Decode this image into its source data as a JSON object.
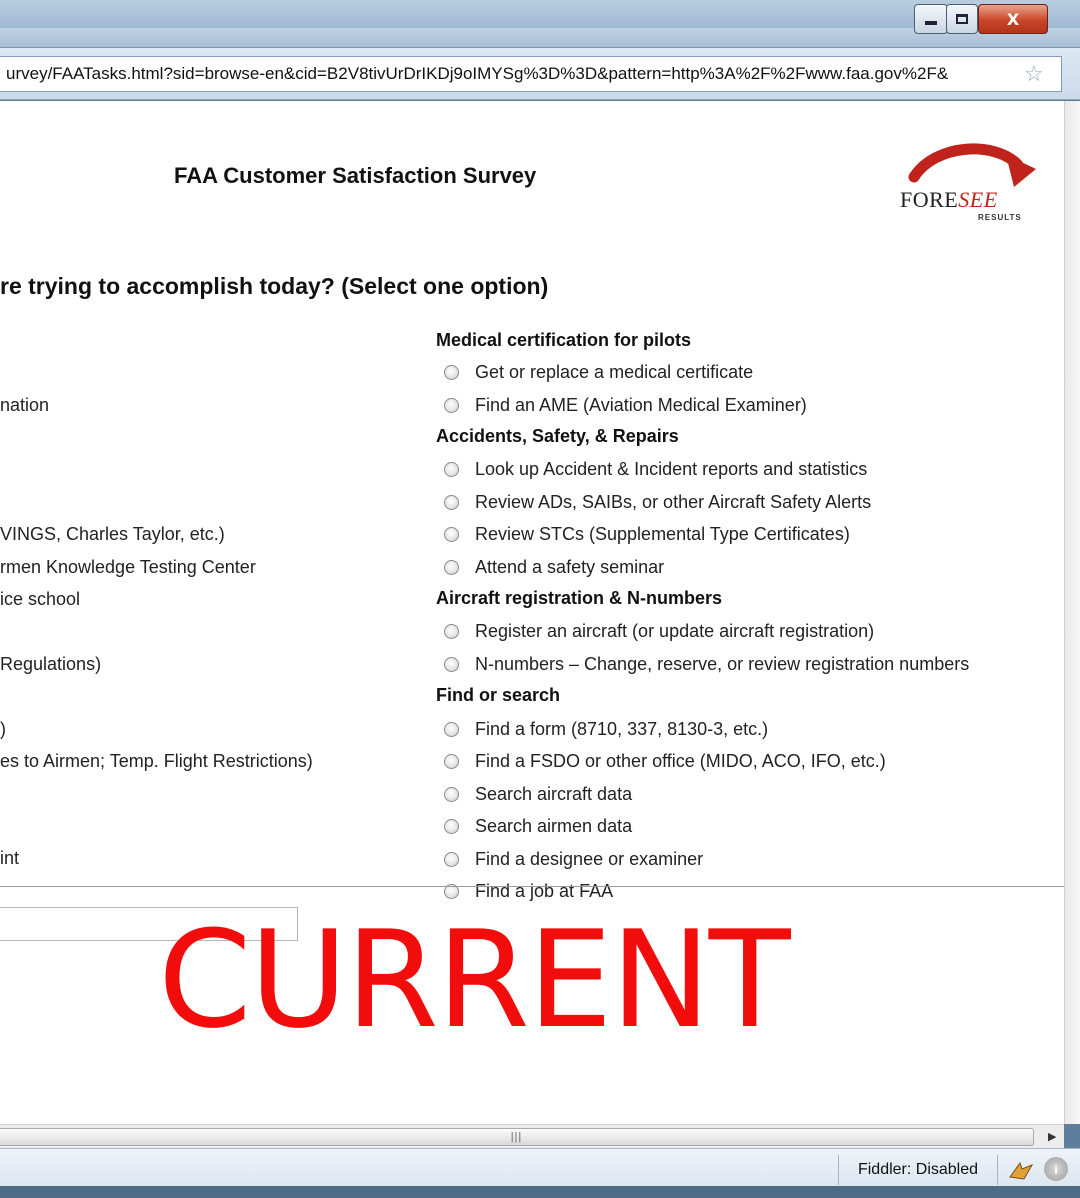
{
  "browser": {
    "url": "urvey/FAATasks.html?sid=browse-en&cid=B2V8tivUrDrIKDj9oIMYSg%3D%3D&pattern=http%3A%2F%2Fwww.faa.gov%2F&",
    "close_label": "X"
  },
  "page": {
    "title": "FAA Customer Satisfaction Survey",
    "logo": {
      "brand_fore": "FORE",
      "brand_see": "SEE",
      "tagline": "RESULTS"
    },
    "question": "re trying to accomplish today? (Select one option)"
  },
  "left_options": [
    "nation",
    "VINGS, Charles Taylor, etc.)",
    "rmen Knowledge Testing Center",
    "ice school",
    "Regulations)",
    ")",
    "es to Airmen; Temp. Flight Restrictions)",
    "int"
  ],
  "categories": [
    {
      "title": "Medical certification for pilots",
      "options": [
        "Get or replace a medical certificate",
        "Find an AME (Aviation Medical Examiner)"
      ]
    },
    {
      "title": "Accidents, Safety, & Repairs",
      "options": [
        "Look up Accident & Incident reports and statistics",
        "Review ADs, SAIBs, or other Aircraft Safety Alerts",
        "Review STCs (Supplemental Type Certificates)",
        "Attend a safety seminar"
      ]
    },
    {
      "title": "Aircraft registration & N-numbers",
      "options": [
        "Register an aircraft (or update aircraft registration)",
        "N-numbers – Change, reserve, or review registration numbers"
      ]
    },
    {
      "title": "Find or search",
      "options": [
        "Find a form (8710, 337, 8130-3, etc.)",
        "Find a FSDO or other office (MIDO, ACO, IFO, etc.)",
        "Search aircraft data",
        "Search airmen data",
        "Find a designee or examiner",
        "Find a job at FAA"
      ]
    }
  ],
  "overlay": {
    "stamp": "CURRENT"
  },
  "statusbar": {
    "fiddler": "Fiddler: Disabled"
  },
  "colors": {
    "stamp": "#f20c0c",
    "logo_arrow": "#c0231b"
  }
}
